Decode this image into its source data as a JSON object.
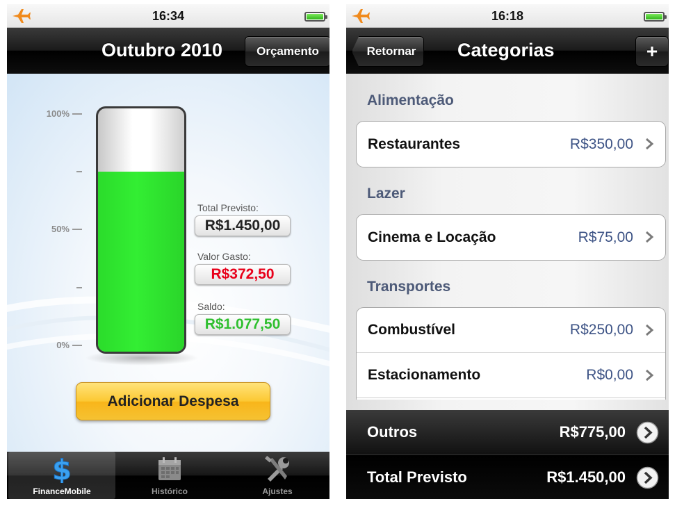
{
  "left_screen": {
    "status_bar": {
      "time": "16:34",
      "airplane_icon": "airplane-icon",
      "battery_icon": "battery-icon"
    },
    "nav": {
      "title": "Outubro 2010",
      "budget_button": "Orçamento"
    },
    "gauge": {
      "scale": [
        "100%",
        "50%",
        "0%"
      ],
      "fill_fraction": 0.74,
      "fill_color": "#33ee33"
    },
    "summary": {
      "total_label": "Total Previsto:",
      "total_value": "R$1.450,00",
      "spent_label": "Valor Gasto:",
      "spent_value": "R$372,50",
      "balance_label": "Saldo:",
      "balance_value": "R$1.077,50"
    },
    "add_expense_button": "Adicionar Despesa",
    "tabs": [
      {
        "label": "FinanceMobile",
        "icon": "dollar-icon",
        "active": true
      },
      {
        "label": "Histórico",
        "icon": "calendar-icon",
        "active": false
      },
      {
        "label": "Ajustes",
        "icon": "tools-icon",
        "active": false
      }
    ],
    "colors": {
      "spent": "#e8001a",
      "balance": "#2fbf2f",
      "accent": "#fcc832"
    }
  },
  "right_screen": {
    "status_bar": {
      "time": "16:18",
      "airplane_icon": "airplane-icon",
      "battery_icon": "battery-icon"
    },
    "nav": {
      "back_button": "Retornar",
      "title": "Categorias",
      "add_button": "+"
    },
    "sections": [
      {
        "header": "Alimentação",
        "items": [
          {
            "label": "Restaurantes",
            "value": "R$350,00"
          }
        ]
      },
      {
        "header": "Lazer",
        "items": [
          {
            "label": "Cinema e Locação",
            "value": "R$75,00"
          }
        ]
      },
      {
        "header": "Transportes",
        "items": [
          {
            "label": "Combustível",
            "value": "R$250,00"
          },
          {
            "label": "Estacionamento",
            "value": "R$0,00"
          }
        ]
      }
    ],
    "totals": [
      {
        "label": "Outros",
        "value": "R$775,00"
      },
      {
        "label": "Total Previsto",
        "value": "R$1.450,00"
      }
    ],
    "colors": {
      "section_header": "#4d5a78",
      "value_text": "#3e5486"
    }
  }
}
